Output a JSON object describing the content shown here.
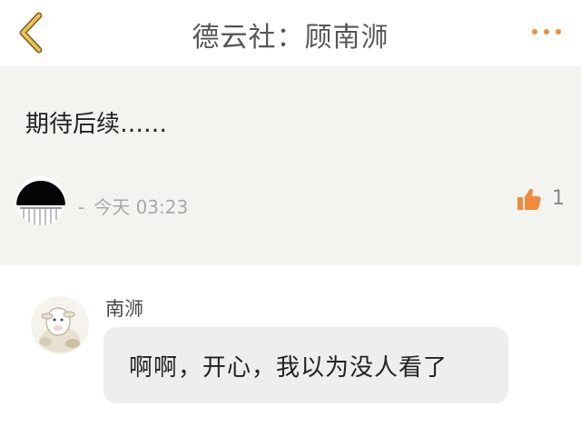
{
  "header": {
    "title": "德云社：顾南浉",
    "back_icon": "chevron-left-icon",
    "more_icon": "more-dots-icon",
    "accent_color": "#f08a3c"
  },
  "post": {
    "text": "期待后续……",
    "meta_separator": "-",
    "timestamp": "今天 03:23",
    "like_icon": "thumbs-up-icon",
    "like_count": "1"
  },
  "reply": {
    "username": "南浉",
    "message": "啊啊，开心，我以为没人看了"
  }
}
